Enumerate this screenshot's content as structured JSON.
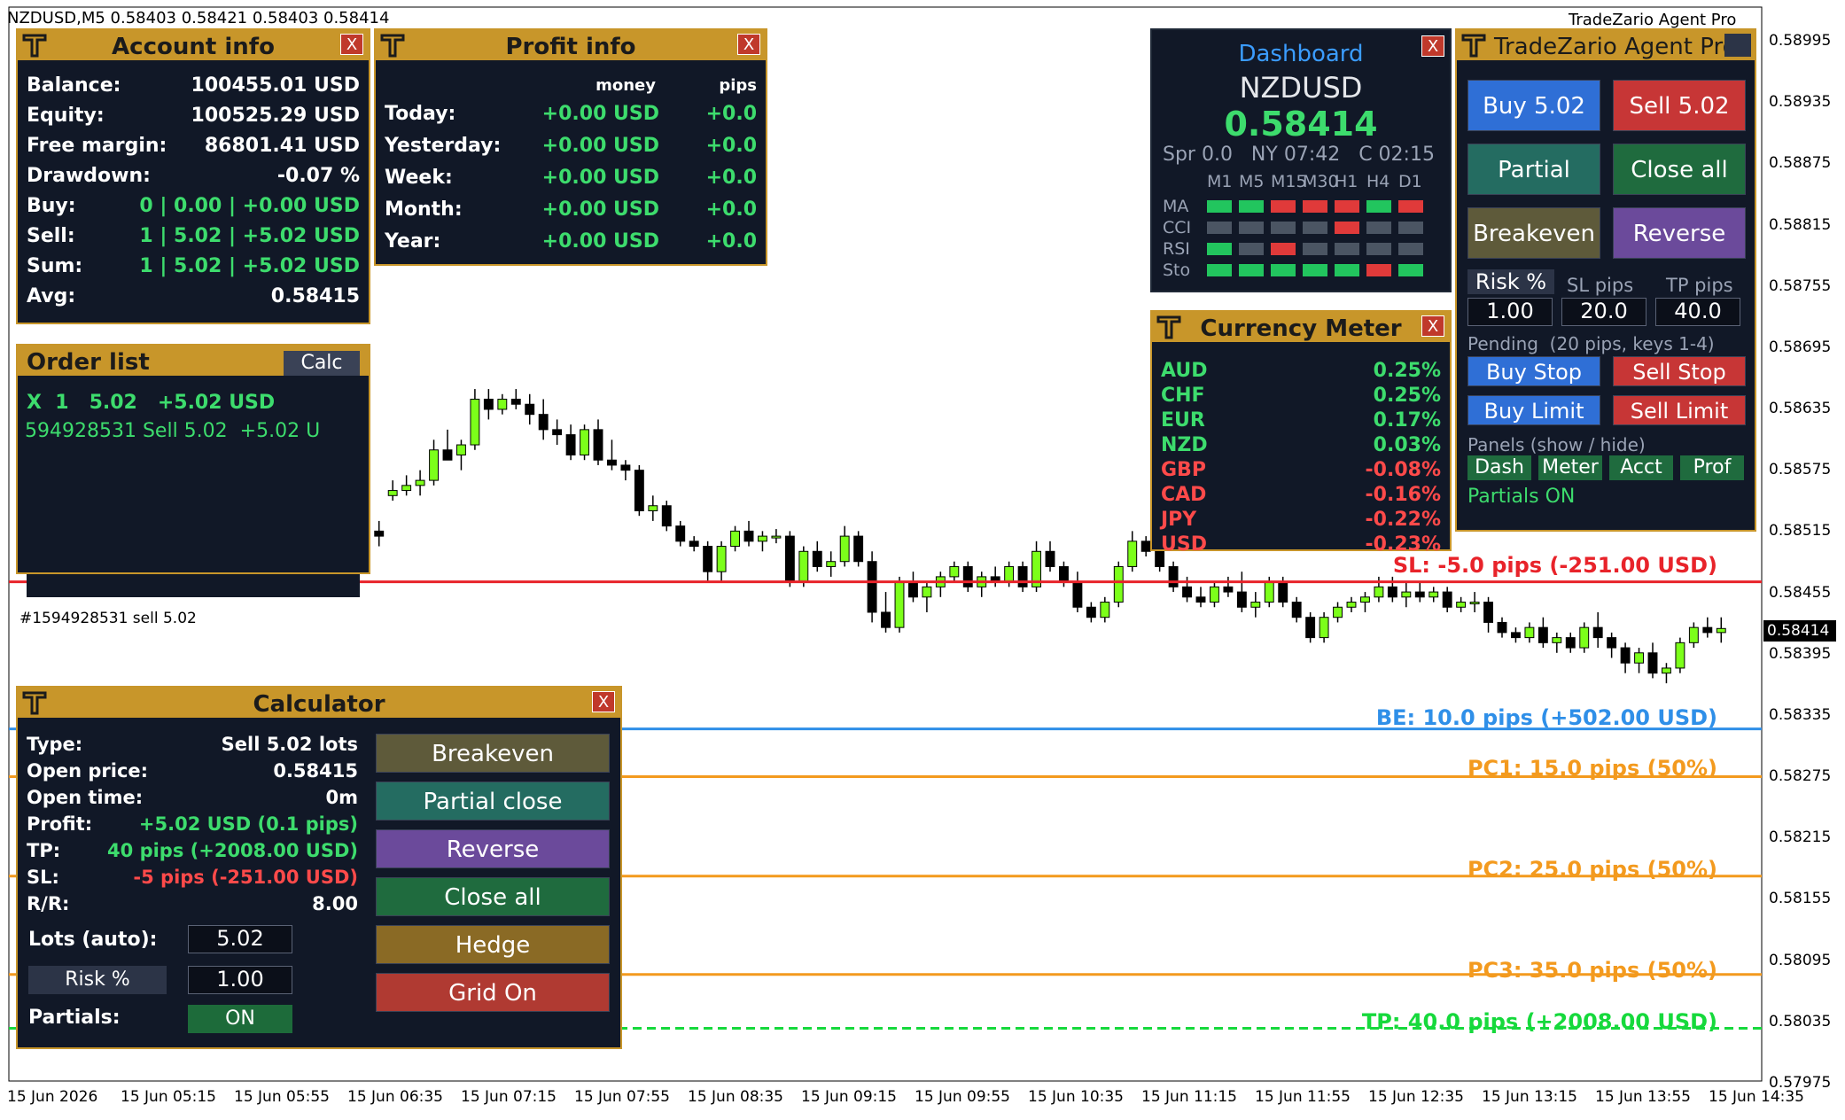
{
  "symbol_header": "NZDUSD,M5  0.58403 0.58421 0.58403 0.58414",
  "brand": "TradeZario Agent Pro",
  "current_price": "0.58414",
  "price_axis": [
    "0.58995",
    "0.58935",
    "0.58875",
    "0.58815",
    "0.58755",
    "0.58695",
    "0.58635",
    "0.58575",
    "0.58515",
    "0.58455",
    "0.58395",
    "0.58335",
    "0.58275",
    "0.58215",
    "0.58155",
    "0.58095",
    "0.58035",
    "0.57975"
  ],
  "time_axis": [
    "15 Jun 2026",
    "15 Jun 05:15",
    "15 Jun 05:55",
    "15 Jun 06:35",
    "15 Jun 07:15",
    "15 Jun 07:55",
    "15 Jun 08:35",
    "15 Jun 09:15",
    "15 Jun 09:55",
    "15 Jun 10:35",
    "15 Jun 11:15",
    "15 Jun 11:55",
    "15 Jun 12:35",
    "15 Jun 13:15",
    "15 Jun 13:55",
    "15 Jun 14:35"
  ],
  "order_comment": "#1594928531 sell 5.02",
  "levels": {
    "sl": "SL: -5.0 pips (-251.00 USD)",
    "be": "BE: 10.0 pips (+502.00 USD)",
    "pc1": "PC1: 15.0 pips (50%)",
    "pc2": "PC2: 25.0 pips (50%)",
    "pc3": "PC3: 35.0 pips (50%)",
    "tp": "TP: 40.0 pips (+2008.00 USD)"
  },
  "level_colors": {
    "sl": "#e8232a",
    "be": "#2f8fe8",
    "pc": "#f39a1e",
    "tp": "#16d93c"
  },
  "account": {
    "title": "Account info",
    "close": "X",
    "rows": [
      {
        "k": "Balance:",
        "v": "100455.01 USD"
      },
      {
        "k": "Equity:",
        "v": "100525.29 USD"
      },
      {
        "k": "Free margin:",
        "v": "86801.41 USD"
      },
      {
        "k": "Drawdown:",
        "v": "-0.07 %"
      },
      {
        "k": "Buy:",
        "v": "0 | 0.00 | +0.00 USD"
      },
      {
        "k": "Sell:",
        "v": "1 | 5.02 | +5.02 USD"
      },
      {
        "k": "Sum:",
        "v": "1 | 5.02 | +5.02 USD"
      },
      {
        "k": "Avg:",
        "v": "0.58415"
      }
    ]
  },
  "profit": {
    "title": "Profit info",
    "close": "X",
    "col_money": "money",
    "col_pips": "pips",
    "rows": [
      {
        "k": "Today:",
        "m": "+0.00 USD",
        "p": "+0.0"
      },
      {
        "k": "Yesterday:",
        "m": "+0.00 USD",
        "p": "+0.0"
      },
      {
        "k": "Week:",
        "m": "+0.00 USD",
        "p": "+0.0"
      },
      {
        "k": "Month:",
        "m": "+0.00 USD",
        "p": "+0.0"
      },
      {
        "k": "Year:",
        "m": "+0.00 USD",
        "p": "+0.0"
      }
    ]
  },
  "orders": {
    "title": "Order list",
    "calc": "Calc",
    "line1": "X  1   5.02   +5.02 USD",
    "line2": "594928531 Sell 5.02  +5.02 U"
  },
  "calculator": {
    "title": "Calculator",
    "close": "X",
    "rows": [
      {
        "k": "Type:",
        "v": "Sell 5.02 lots"
      },
      {
        "k": "Open price:",
        "v": "0.58415"
      },
      {
        "k": "Open time:",
        "v": "0m"
      },
      {
        "k": "Profit:",
        "v": "+5.02 USD (0.1 pips)"
      },
      {
        "k": "TP:",
        "v": "40 pips (+2008.00 USD)"
      },
      {
        "k": "SL:",
        "v": "-5 pips (-251.00 USD)"
      },
      {
        "k": "R/R:",
        "v": "8.00"
      }
    ],
    "lots_label": "Lots (auto):",
    "lots_value": "5.02",
    "risk_label": "Risk %",
    "risk_value": "1.00",
    "partials_label": "Partials:",
    "partials_value": "ON",
    "buttons": [
      "Breakeven",
      "Partial close",
      "Reverse",
      "Close all",
      "Hedge",
      "Grid On"
    ]
  },
  "dashboard": {
    "title": "Dashboard",
    "close": "X",
    "symbol": "NZDUSD",
    "price": "0.58414",
    "info": "Spr 0.0   NY 07:42   C 02:15",
    "timeframes": [
      "M1",
      "M5",
      "M15",
      "M30",
      "H1",
      "H4",
      "D1"
    ],
    "indicators": [
      {
        "name": "MA",
        "cells": [
          "g",
          "g",
          "r",
          "r",
          "r",
          "g",
          "r"
        ]
      },
      {
        "name": "CCI",
        "cells": [
          "n",
          "n",
          "n",
          "n",
          "r",
          "n",
          "n"
        ]
      },
      {
        "name": "RSI",
        "cells": [
          "g",
          "n",
          "r",
          "n",
          "n",
          "n",
          "n"
        ]
      },
      {
        "name": "Sto",
        "cells": [
          "g",
          "g",
          "g",
          "g",
          "g",
          "r",
          "g"
        ]
      }
    ]
  },
  "meter": {
    "title": "Currency Meter",
    "close": "X",
    "rows": [
      {
        "k": "AUD",
        "v": "0.25%",
        "pos": true
      },
      {
        "k": "CHF",
        "v": "0.25%",
        "pos": true
      },
      {
        "k": "EUR",
        "v": "0.17%",
        "pos": true
      },
      {
        "k": "NZD",
        "v": "0.03%",
        "pos": true
      },
      {
        "k": "GBP",
        "v": "-0.08%",
        "pos": false
      },
      {
        "k": "CAD",
        "v": "-0.16%",
        "pos": false
      },
      {
        "k": "JPY",
        "v": "-0.22%",
        "pos": false
      },
      {
        "k": "USD",
        "v": "-0.23%",
        "pos": false
      }
    ]
  },
  "agent": {
    "title": "TradeZario Agent Pro",
    "buy": "Buy 5.02",
    "sell": "Sell 5.02",
    "partial": "Partial",
    "close_all": "Close all",
    "breakeven": "Breakeven",
    "reverse": "Reverse",
    "risk_label": "Risk %",
    "sl_label": "SL pips",
    "tp_label": "TP pips",
    "risk_value": "1.00",
    "sl_value": "20.0",
    "tp_value": "40.0",
    "pending_label": "Pending  (20 pips, keys 1-4)",
    "buy_stop": "Buy Stop",
    "sell_stop": "Sell Stop",
    "buy_limit": "Buy Limit",
    "sell_limit": "Sell Limit",
    "panels_label": "Panels (show / hide)",
    "panel_buttons": [
      "Dash",
      "Meter",
      "Acct",
      "Prof"
    ],
    "partials_status": "Partials ON"
  },
  "chart_data": {
    "type": "candlestick",
    "ylim": [
      0.57975,
      0.58995
    ],
    "candles": [
      [
        0.5851,
        0.5852,
        0.58495,
        0.58505
      ],
      [
        0.58545,
        0.5856,
        0.5854,
        0.5855
      ],
      [
        0.5855,
        0.58565,
        0.58545,
        0.58555
      ],
      [
        0.58555,
        0.5857,
        0.58545,
        0.5856
      ],
      [
        0.5856,
        0.586,
        0.58555,
        0.5859
      ],
      [
        0.5859,
        0.5861,
        0.5858,
        0.5858
      ],
      [
        0.58585,
        0.586,
        0.5857,
        0.58595
      ],
      [
        0.58595,
        0.5865,
        0.5859,
        0.5864
      ],
      [
        0.5864,
        0.5865,
        0.5862,
        0.5863
      ],
      [
        0.5863,
        0.58645,
        0.58625,
        0.5864
      ],
      [
        0.5864,
        0.5865,
        0.5863,
        0.58635
      ],
      [
        0.58635,
        0.58645,
        0.58615,
        0.58625
      ],
      [
        0.58625,
        0.5864,
        0.586,
        0.5861
      ],
      [
        0.5861,
        0.5862,
        0.58595,
        0.58605
      ],
      [
        0.58605,
        0.58615,
        0.5858,
        0.58585
      ],
      [
        0.58585,
        0.58615,
        0.5858,
        0.5861
      ],
      [
        0.5861,
        0.5862,
        0.58575,
        0.5858
      ],
      [
        0.5858,
        0.586,
        0.5857,
        0.58575
      ],
      [
        0.58575,
        0.5858,
        0.5856,
        0.5857
      ],
      [
        0.5857,
        0.58575,
        0.58525,
        0.5853
      ],
      [
        0.5853,
        0.58545,
        0.5852,
        0.58535
      ],
      [
        0.58535,
        0.5854,
        0.5851,
        0.58515
      ],
      [
        0.58515,
        0.5852,
        0.58495,
        0.585
      ],
      [
        0.585,
        0.58505,
        0.5849,
        0.58495
      ],
      [
        0.58495,
        0.585,
        0.5846,
        0.5847
      ],
      [
        0.5847,
        0.585,
        0.5846,
        0.58495
      ],
      [
        0.58495,
        0.58515,
        0.5849,
        0.5851
      ],
      [
        0.5851,
        0.5852,
        0.58495,
        0.585
      ],
      [
        0.585,
        0.5851,
        0.5849,
        0.58505
      ],
      [
        0.58505,
        0.58512,
        0.58498,
        0.58505
      ],
      [
        0.58505,
        0.5851,
        0.58455,
        0.5846
      ],
      [
        0.5846,
        0.58495,
        0.58455,
        0.5849
      ],
      [
        0.5849,
        0.585,
        0.5847,
        0.58475
      ],
      [
        0.58475,
        0.5849,
        0.58465,
        0.5848
      ],
      [
        0.5848,
        0.58515,
        0.58475,
        0.58505
      ],
      [
        0.58505,
        0.5851,
        0.58475,
        0.5848
      ],
      [
        0.5848,
        0.5849,
        0.5842,
        0.5843
      ],
      [
        0.5843,
        0.5845,
        0.5841,
        0.58415
      ],
      [
        0.58415,
        0.58465,
        0.5841,
        0.5846
      ],
      [
        0.5846,
        0.5847,
        0.5844,
        0.58445
      ],
      [
        0.58445,
        0.5846,
        0.5843,
        0.58455
      ],
      [
        0.58455,
        0.5847,
        0.58445,
        0.58465
      ],
      [
        0.58465,
        0.5848,
        0.5846,
        0.58475
      ],
      [
        0.58475,
        0.5848,
        0.5845,
        0.58455
      ],
      [
        0.58455,
        0.5847,
        0.58445,
        0.58465
      ],
      [
        0.58465,
        0.58475,
        0.58455,
        0.5846
      ],
      [
        0.5846,
        0.5848,
        0.58455,
        0.58475
      ],
      [
        0.58475,
        0.5848,
        0.5845,
        0.58455
      ],
      [
        0.58455,
        0.585,
        0.5845,
        0.5849
      ],
      [
        0.5849,
        0.585,
        0.5847,
        0.58475
      ],
      [
        0.58475,
        0.5848,
        0.58455,
        0.5846
      ],
      [
        0.5846,
        0.5847,
        0.5843,
        0.58435
      ],
      [
        0.58435,
        0.5844,
        0.5842,
        0.58425
      ],
      [
        0.58425,
        0.58445,
        0.5842,
        0.5844
      ],
      [
        0.5844,
        0.5848,
        0.58435,
        0.58475
      ],
      [
        0.58475,
        0.5851,
        0.5847,
        0.585
      ],
      [
        0.585,
        0.58505,
        0.58485,
        0.5849
      ],
      [
        0.5849,
        0.58495,
        0.5847,
        0.58475
      ],
      [
        0.58475,
        0.5848,
        0.5845,
        0.58455
      ],
      [
        0.58455,
        0.58465,
        0.5844,
        0.58445
      ],
      [
        0.58445,
        0.58455,
        0.58435,
        0.5844
      ],
      [
        0.5844,
        0.5846,
        0.58435,
        0.58455
      ],
      [
        0.58455,
        0.58465,
        0.58445,
        0.5845
      ],
      [
        0.5845,
        0.5847,
        0.5843,
        0.58435
      ],
      [
        0.58435,
        0.5845,
        0.58425,
        0.5844
      ],
      [
        0.5844,
        0.58465,
        0.58435,
        0.5846
      ],
      [
        0.5846,
        0.58465,
        0.58435,
        0.5844
      ],
      [
        0.5844,
        0.58445,
        0.5842,
        0.58425
      ],
      [
        0.58425,
        0.5843,
        0.584,
        0.58405
      ],
      [
        0.58405,
        0.5843,
        0.584,
        0.58425
      ],
      [
        0.58425,
        0.5844,
        0.5842,
        0.58435
      ],
      [
        0.58435,
        0.58445,
        0.5843,
        0.5844
      ],
      [
        0.5844,
        0.5845,
        0.5843,
        0.58445
      ],
      [
        0.58445,
        0.58465,
        0.5844,
        0.58455
      ],
      [
        0.58455,
        0.58465,
        0.5844,
        0.58445
      ],
      [
        0.58445,
        0.5846,
        0.58435,
        0.5845
      ],
      [
        0.5845,
        0.5846,
        0.5844,
        0.58445
      ],
      [
        0.58445,
        0.58455,
        0.5844,
        0.5845
      ],
      [
        0.5845,
        0.58455,
        0.5843,
        0.58435
      ],
      [
        0.58435,
        0.58445,
        0.5843,
        0.5844
      ],
      [
        0.5844,
        0.5845,
        0.5843,
        0.5844
      ],
      [
        0.5844,
        0.58445,
        0.5841,
        0.5842
      ],
      [
        0.5842,
        0.58425,
        0.58405,
        0.5841
      ],
      [
        0.5841,
        0.58415,
        0.584,
        0.58405
      ],
      [
        0.58405,
        0.5842,
        0.584,
        0.58415
      ],
      [
        0.58415,
        0.58425,
        0.58395,
        0.584
      ],
      [
        0.584,
        0.5841,
        0.5839,
        0.58405
      ],
      [
        0.58405,
        0.5841,
        0.5839,
        0.58395
      ],
      [
        0.58395,
        0.5842,
        0.5839,
        0.58415
      ],
      [
        0.58415,
        0.5843,
        0.58395,
        0.58405
      ],
      [
        0.58405,
        0.5841,
        0.58385,
        0.58395
      ],
      [
        0.58395,
        0.584,
        0.5837,
        0.5838
      ],
      [
        0.5838,
        0.58395,
        0.5837,
        0.5839
      ],
      [
        0.5839,
        0.584,
        0.58365,
        0.5837
      ],
      [
        0.5837,
        0.5838,
        0.5836,
        0.58375
      ],
      [
        0.58375,
        0.58405,
        0.5837,
        0.584
      ],
      [
        0.584,
        0.5842,
        0.58395,
        0.58415
      ],
      [
        0.58415,
        0.58425,
        0.58405,
        0.5841
      ],
      [
        0.5841,
        0.58425,
        0.584,
        0.58414
      ]
    ],
    "levels": {
      "sl": 0.5846,
      "be": 0.58315,
      "pc1": 0.58268,
      "pc2": 0.5817,
      "pc3": 0.58073,
      "tp": 0.5802
    }
  }
}
